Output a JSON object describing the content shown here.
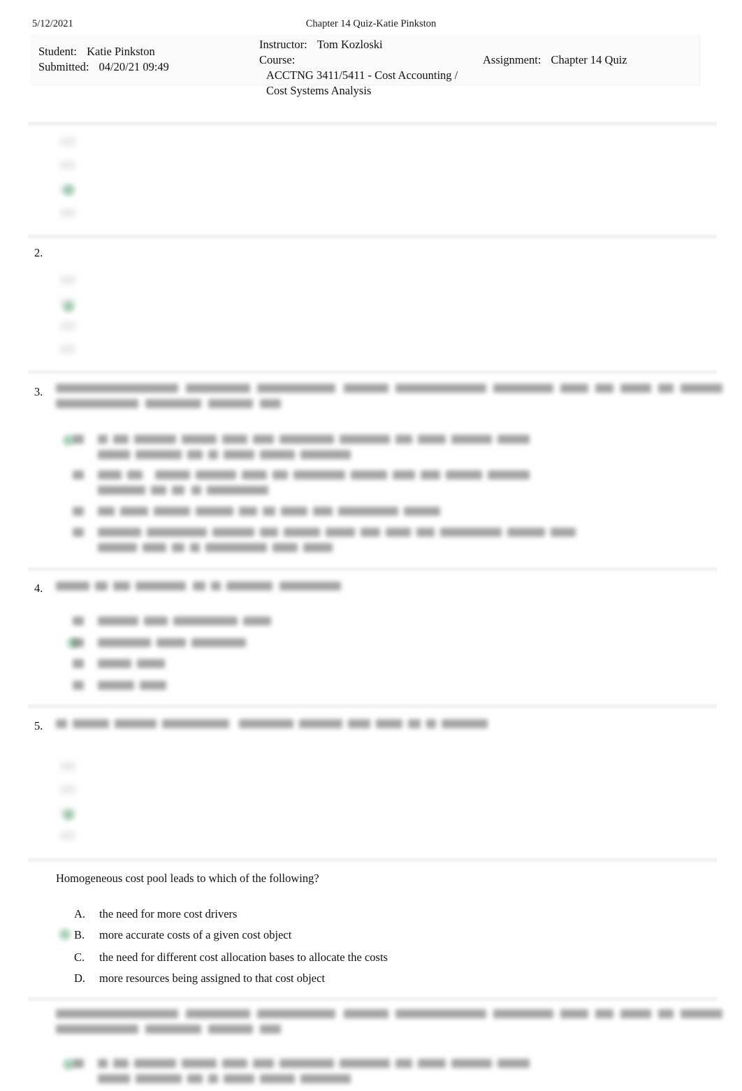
{
  "page": {
    "date": "5/12/2021",
    "doc_title": "Chapter 14 Quiz-Katie Pinkston"
  },
  "info": {
    "student_label": "Student:",
    "student_value": "Katie Pinkston",
    "submitted_label": "Submitted:",
    "submitted_value": "04/20/21 09:49",
    "instructor_label": "Instructor:",
    "instructor_value": "Tom Kozloski",
    "course_label": "Course:",
    "course_value": "ACCTNG 3411/5411 - Cost Accounting / Cost Systems Analysis",
    "assignment_label": "Assignment:",
    "assignment_value": "Chapter 14 Quiz"
  },
  "questions": [
    {
      "number": "",
      "text": "",
      "options": [],
      "selected": "C",
      "state": "faded"
    },
    {
      "number": "2.",
      "text": "",
      "options": [],
      "selected": "B",
      "state": "faded"
    },
    {
      "number": "3.",
      "text": "",
      "options": [
        {
          "letter": "A",
          "text": ""
        },
        {
          "letter": "B",
          "text": ""
        },
        {
          "letter": "C",
          "text": ""
        },
        {
          "letter": "D",
          "text": ""
        }
      ],
      "selected": "A",
      "state": "blurred"
    },
    {
      "number": "4.",
      "text": "",
      "options": [
        {
          "letter": "A",
          "text": ""
        },
        {
          "letter": "B",
          "text": ""
        },
        {
          "letter": "C",
          "text": ""
        },
        {
          "letter": "D",
          "text": ""
        }
      ],
      "selected": "B",
      "state": "blurred"
    },
    {
      "number": "5.",
      "text": "",
      "options": [],
      "selected": "C",
      "state": "blurred-heading-faded-options"
    },
    {
      "number": "",
      "text": "Homogeneous cost pool leads to which of the following?",
      "options": [
        {
          "letter": "A.",
          "text": "the need for more cost drivers"
        },
        {
          "letter": "B.",
          "text": "more accurate costs of a given cost object"
        },
        {
          "letter": "C.",
          "text": "the need for different cost allocation bases to allocate the costs"
        },
        {
          "letter": "D.",
          "text": "more resources being assigned to that cost object"
        }
      ],
      "selected": "B.",
      "state": "legible"
    },
    {
      "number": "",
      "text": "",
      "options": [
        {
          "letter": "A",
          "text": ""
        }
      ],
      "selected": "A",
      "state": "blurred"
    }
  ],
  "colors": {
    "selected_mark": "#78b892",
    "divider": "#f2f2f2",
    "infobox_bg": "#fbfbfb",
    "text": "#111111"
  }
}
